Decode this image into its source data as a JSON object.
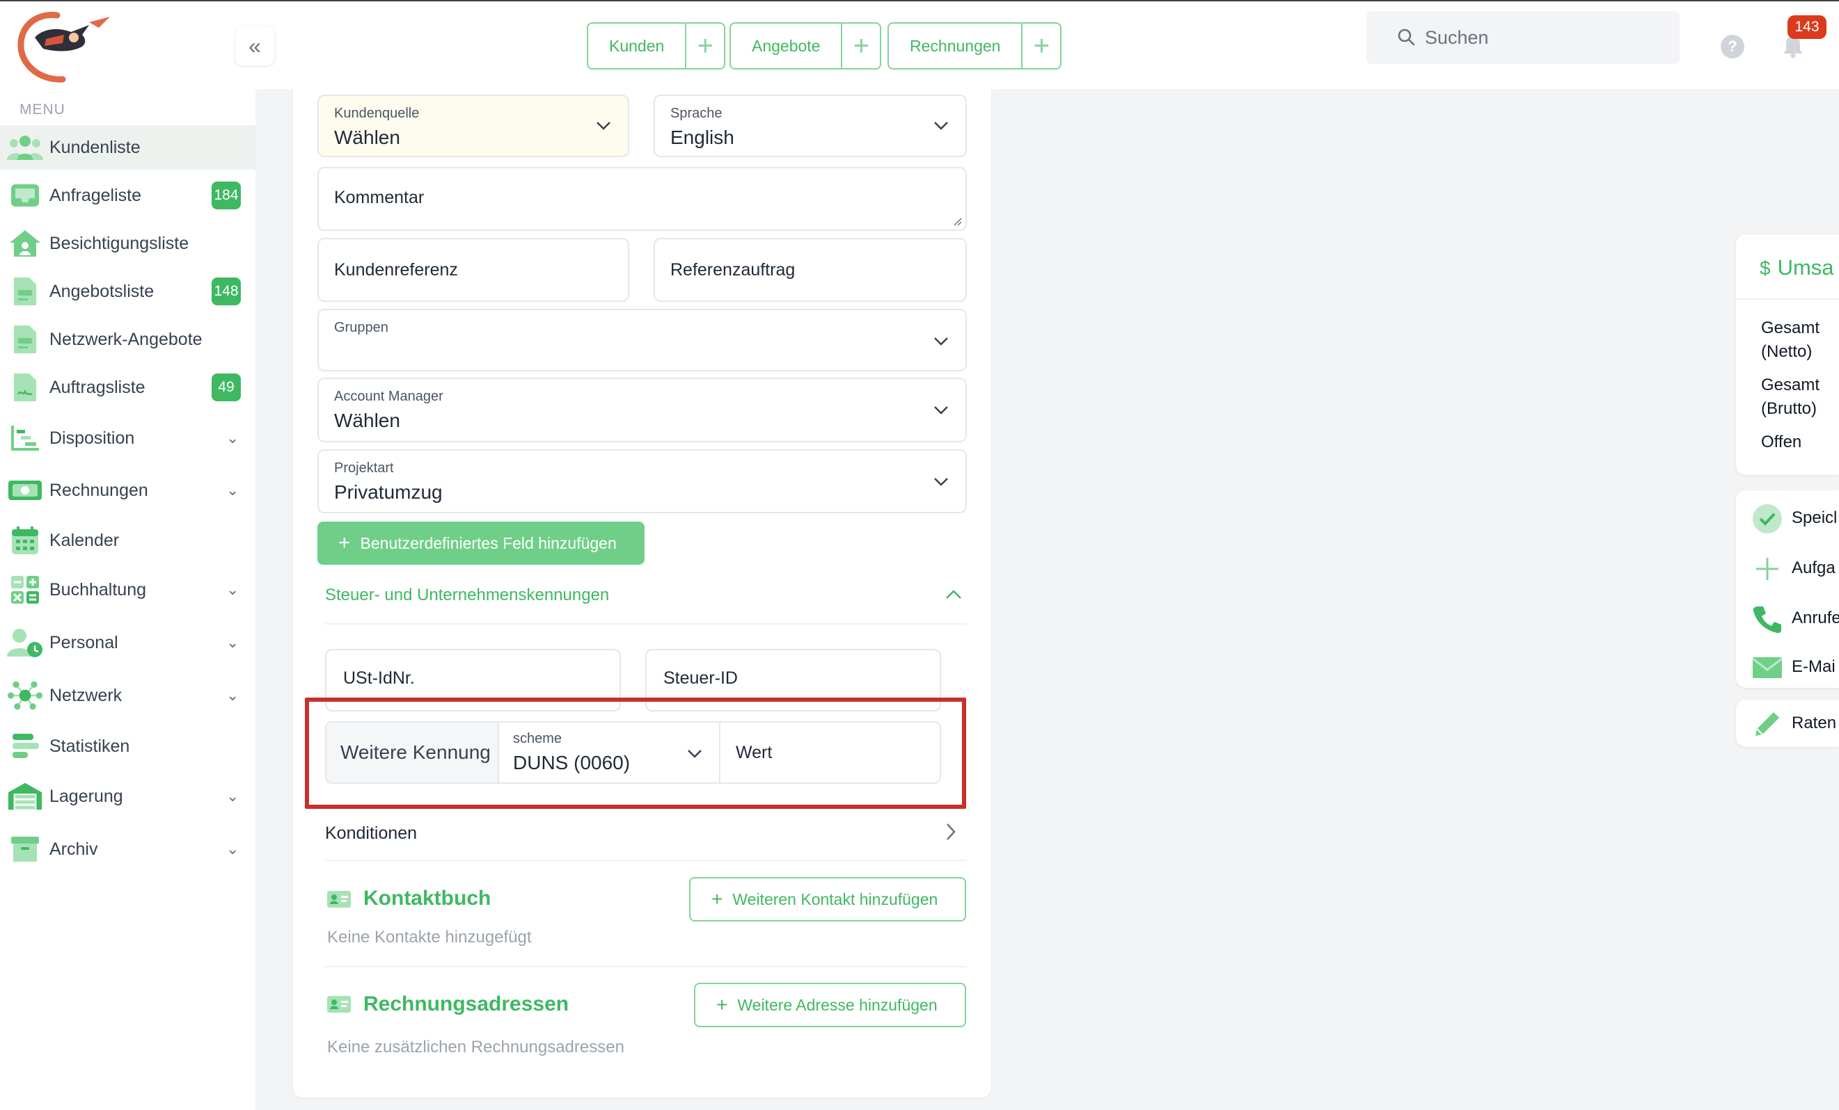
{
  "header": {
    "quick_actions": [
      {
        "label": "Kunden"
      },
      {
        "label": "Angebote"
      },
      {
        "label": "Rechnungen"
      }
    ],
    "search_placeholder": "Suchen",
    "help_label": "?",
    "notification_count": "143"
  },
  "sidebar": {
    "menu_label": "MENU",
    "items": [
      {
        "label": "Kundenliste",
        "badge": "",
        "icon": "users-icon"
      },
      {
        "label": "Anfrageliste",
        "badge": "184",
        "icon": "inbox-icon"
      },
      {
        "label": "Besichtigungsliste",
        "badge": "",
        "icon": "house-icon"
      },
      {
        "label": "Angebotsliste",
        "badge": "148",
        "icon": "document-icon"
      },
      {
        "label": "Netzwerk-Angebote",
        "badge": "",
        "icon": "document-icon"
      },
      {
        "label": "Auftragsliste",
        "badge": "49",
        "icon": "signed-document-icon"
      },
      {
        "label": "Disposition",
        "badge": "",
        "icon": "gantt-icon"
      },
      {
        "label": "Rechnungen",
        "badge": "",
        "icon": "money-icon"
      },
      {
        "label": "Kalender",
        "badge": "",
        "icon": "calendar-icon"
      },
      {
        "label": "Buchhaltung",
        "badge": "",
        "icon": "calculator-icon"
      },
      {
        "label": "Personal",
        "badge": "",
        "icon": "person-clock-icon"
      },
      {
        "label": "Netzwerk",
        "badge": "",
        "icon": "network-icon"
      },
      {
        "label": "Statistiken",
        "badge": "",
        "icon": "bar-chart-icon"
      },
      {
        "label": "Lagerung",
        "badge": "",
        "icon": "warehouse-icon"
      },
      {
        "label": "Archiv",
        "badge": "",
        "icon": "archive-icon"
      }
    ]
  },
  "form": {
    "kundenquelle": {
      "label": "Kundenquelle",
      "value": "Wählen"
    },
    "sprache": {
      "label": "Sprache",
      "value": "English"
    },
    "kommentar": {
      "placeholder": "Kommentar"
    },
    "kundenreferenz": {
      "placeholder": "Kundenreferenz"
    },
    "referenzauftrag": {
      "placeholder": "Referenzauftrag"
    },
    "gruppen": {
      "label": "Gruppen",
      "value": ""
    },
    "account_manager": {
      "label": "Account Manager",
      "value": "Wählen"
    },
    "projektart": {
      "label": "Projektart",
      "value": "Privatumzug"
    },
    "add_custom_field": "Benutzerdefiniertes Feld hinzufügen",
    "tax_section": {
      "title": "Steuer- und Unternehmenskennungen",
      "ust_id": "USt-IdNr.",
      "steuer_id": "Steuer-ID",
      "weitere_kennung": "Weitere Kennung",
      "scheme_label": "scheme",
      "scheme_value": "DUNS (0060)",
      "wert": "Wert"
    },
    "konditionen": "Konditionen",
    "kontaktbuch": {
      "title": "Kontaktbuch",
      "button": "Weiteren Kontakt hinzufügen",
      "empty": "Keine Kontakte hinzugefügt"
    },
    "rechnungsadressen": {
      "title": "Rechnungsadressen",
      "button": "Weitere Adresse hinzufügen",
      "empty": "Keine zusätzlichen Rechnungsadressen"
    }
  },
  "right_panel": {
    "revenue_title": "Umsa",
    "revenue_symbol": "$",
    "rows": [
      "Gesamt (Netto)",
      "Gesamt (Brutto)",
      "Offen"
    ],
    "actions": [
      "Speicl",
      "Aufga",
      "Anrufe",
      "E-Mai"
    ],
    "raten": "Raten"
  },
  "colors": {
    "accent": "#3fb862",
    "accent_light": "#86d29a",
    "badge_red": "#dc3a1e",
    "highlight": "#c8302a"
  }
}
